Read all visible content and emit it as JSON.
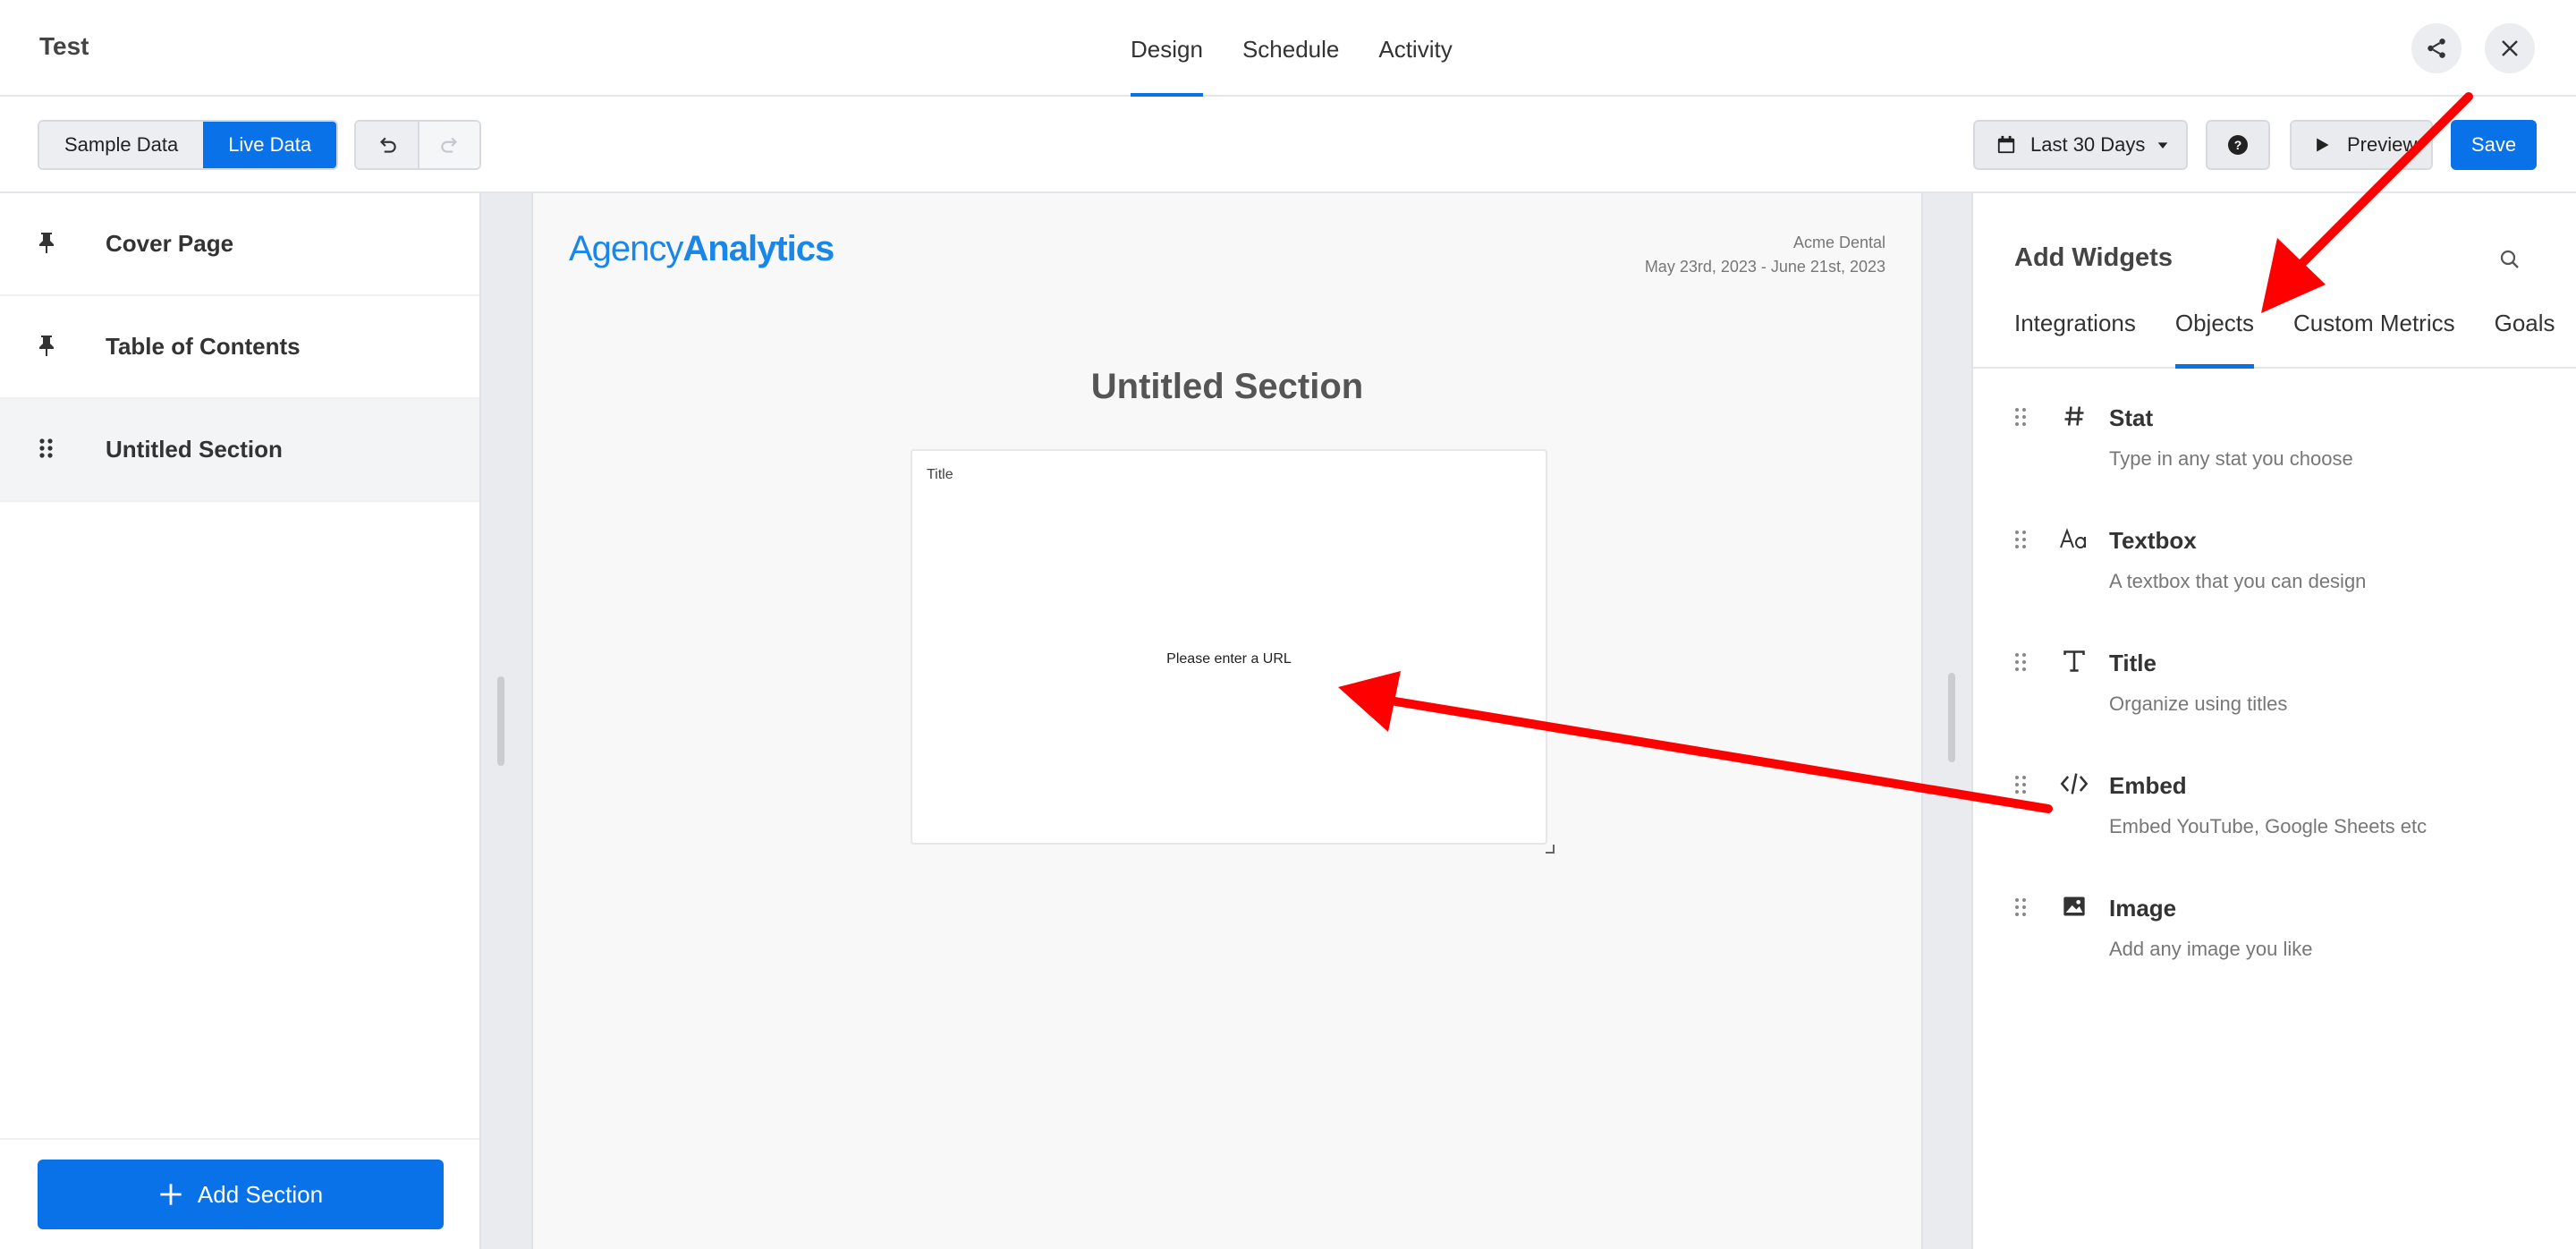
{
  "header": {
    "title": "Test",
    "tabs": [
      "Design",
      "Schedule",
      "Activity"
    ],
    "active_tab": "Design"
  },
  "toolbar": {
    "sample_data_label": "Sample Data",
    "live_data_label": "Live Data",
    "date_range_label": "Last 30 Days",
    "preview_label": "Preview",
    "save_label": "Save"
  },
  "sidebar": {
    "items": [
      {
        "label": "Cover Page",
        "icon": "pin-icon"
      },
      {
        "label": "Table of Contents",
        "icon": "pin-icon"
      },
      {
        "label": "Untitled Section",
        "icon": "drag-handle-icon"
      }
    ],
    "add_section_label": "Add Section"
  },
  "report": {
    "logo_light": "Agency",
    "logo_bold": "Analytics",
    "client_name": "Acme Dental",
    "date_range": "May 23rd, 2023 - June 21st, 2023",
    "section_title": "Untitled Section",
    "widget_title": "Title",
    "widget_message": "Please enter a URL"
  },
  "panel": {
    "title": "Add Widgets",
    "tabs": [
      "Integrations",
      "Objects",
      "Custom Metrics",
      "Goals"
    ],
    "active_tab": "Objects",
    "objects": [
      {
        "name": "Stat",
        "description": "Type in any stat you choose",
        "icon": "hash-icon"
      },
      {
        "name": "Textbox",
        "description": "A textbox that you can design",
        "icon": "text-style-icon"
      },
      {
        "name": "Title",
        "description": "Organize using titles",
        "icon": "title-t-icon"
      },
      {
        "name": "Embed",
        "description": "Embed YouTube, Google Sheets etc",
        "icon": "code-icon"
      },
      {
        "name": "Image",
        "description": "Add any image you like",
        "icon": "image-icon"
      }
    ]
  },
  "colors": {
    "accent": "#0a72e8",
    "annotation_arrow": "#ff0000"
  }
}
